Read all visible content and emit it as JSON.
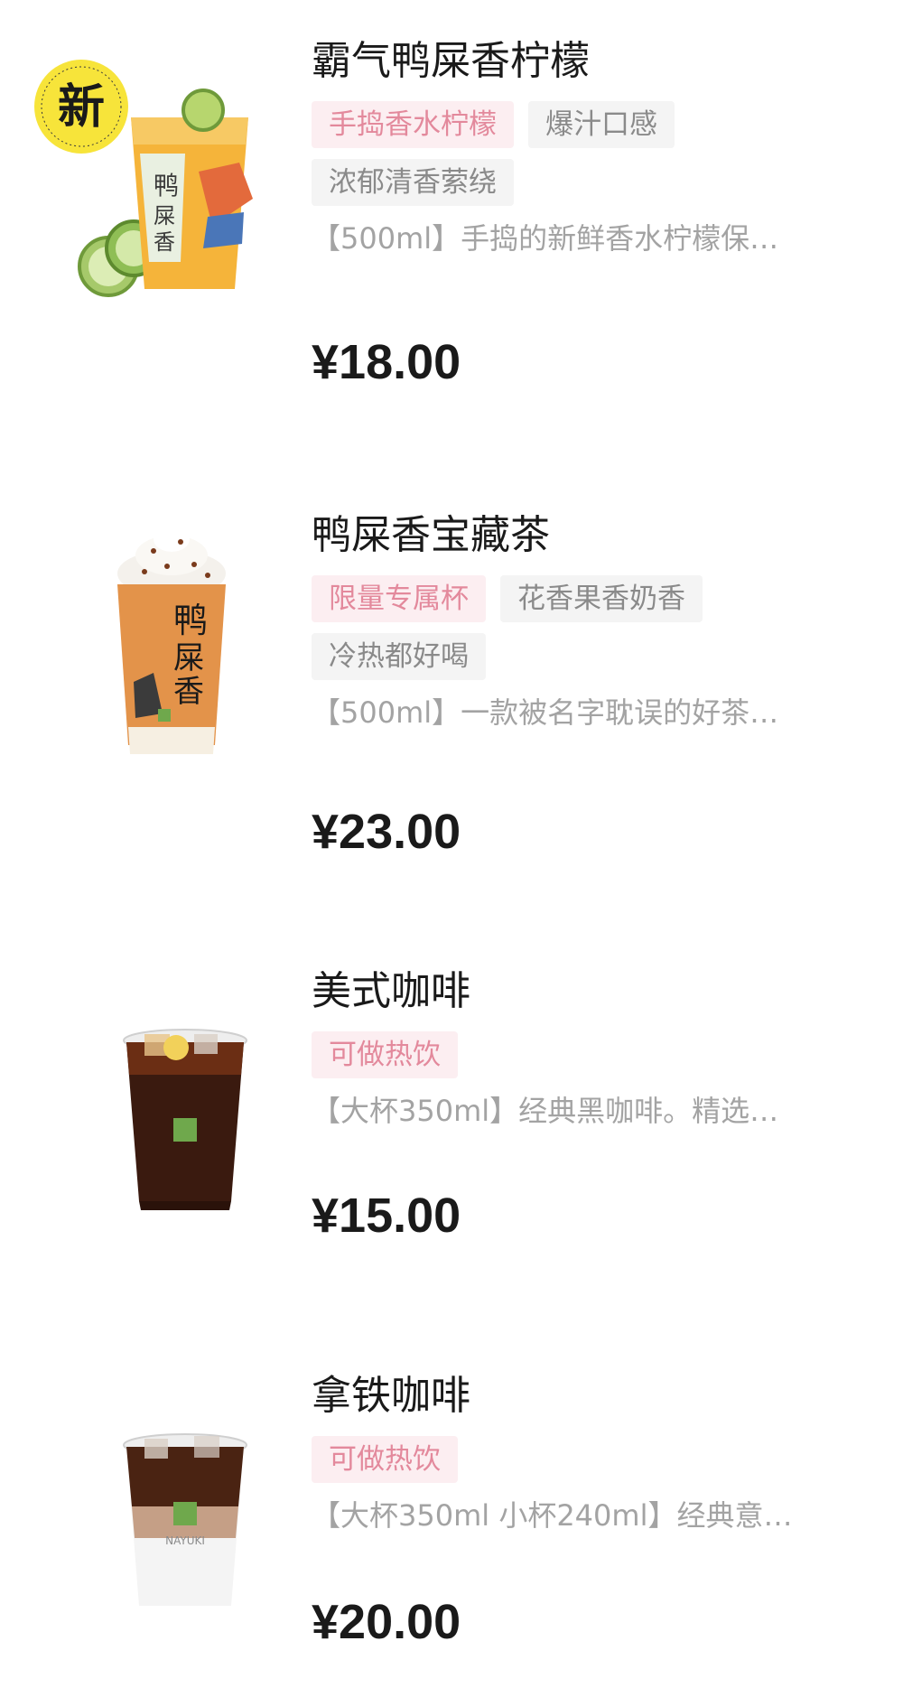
{
  "products": [
    {
      "name": "霸气鸭屎香柠檬",
      "badge": "新",
      "tags": [
        {
          "label": "手捣香水柠檬",
          "style": "pink"
        },
        {
          "label": "爆汁口感",
          "style": "gray"
        },
        {
          "label": "浓郁清香萦绕",
          "style": "gray"
        }
      ],
      "description": "【500ml】手捣的新鲜香水柠檬保…",
      "price": "¥18.00"
    },
    {
      "name": "鸭屎香宝藏茶",
      "tags": [
        {
          "label": "限量专属杯",
          "style": "pink"
        },
        {
          "label": "花香果香奶香",
          "style": "gray"
        },
        {
          "label": "冷热都好喝",
          "style": "gray"
        }
      ],
      "description": "【500ml】一款被名字耽误的好茶…",
      "price": "¥23.00"
    },
    {
      "name": "美式咖啡",
      "tags": [
        {
          "label": "可做热饮",
          "style": "pink"
        }
      ],
      "description": "【大杯350ml】经典黑咖啡。精选…",
      "price": "¥15.00"
    },
    {
      "name": "拿铁咖啡",
      "tags": [
        {
          "label": "可做热饮",
          "style": "pink"
        }
      ],
      "description": "【大杯350ml 小杯240ml】经典意…",
      "price": "¥20.00"
    }
  ],
  "colors": {
    "tag_pink_bg": "#fceef1",
    "tag_pink_text": "#e3899c",
    "tag_gray_bg": "#f4f4f4",
    "tag_gray_text": "#8a8a8a"
  }
}
